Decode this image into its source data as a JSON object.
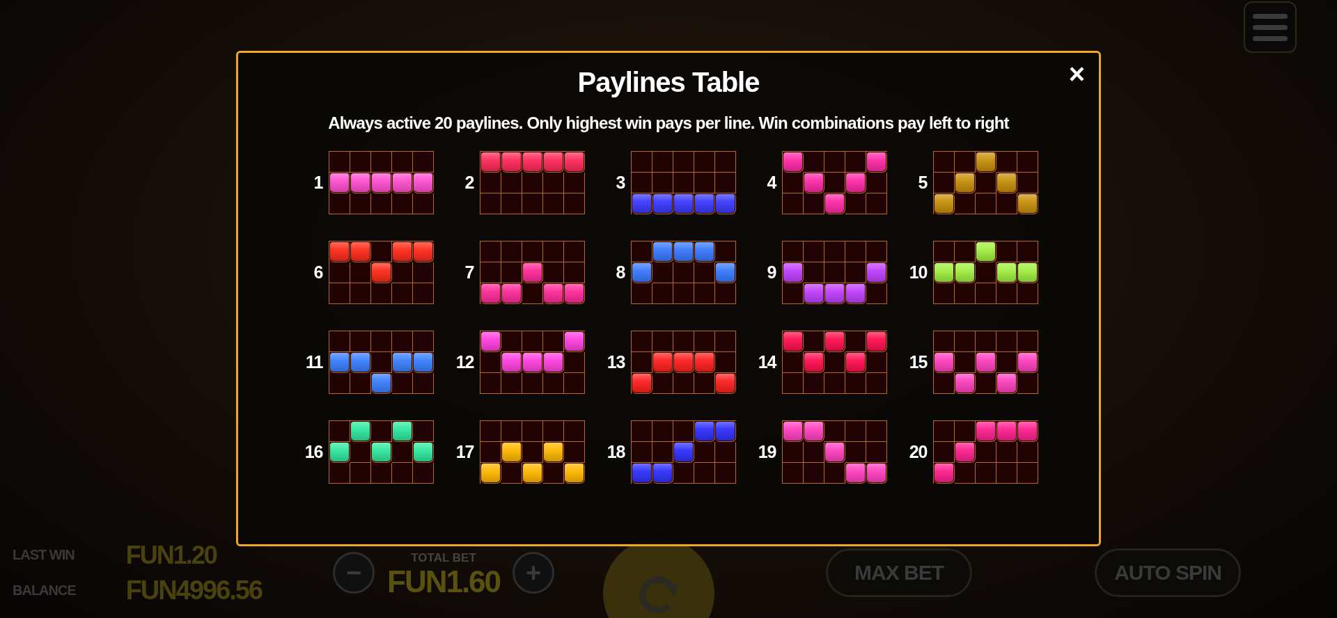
{
  "menu_button": {
    "kind": "menu"
  },
  "hud": {
    "last_win_label": "LAST WIN",
    "last_win": "FUN1.20",
    "balance_label": "BALANCE",
    "balance": "FUN4996.56",
    "total_bet_label": "TOTAL BET",
    "total_bet": "FUN1.60",
    "minus": "−",
    "plus": "+",
    "max_bet": "MAX BET",
    "auto_spin": "AUTO SPIN"
  },
  "modal": {
    "title": "Paylines Table",
    "close": "×",
    "subtitle": "Always active 20 paylines. Only highest win pays per line. Win combinations pay left to right"
  },
  "paylines": [
    {
      "number": "1",
      "color": "#ff4fd0",
      "grid": [
        [
          false,
          false,
          false,
          false,
          false
        ],
        [
          true,
          true,
          true,
          true,
          true
        ],
        [
          false,
          false,
          false,
          false,
          false
        ]
      ]
    },
    {
      "number": "2",
      "color": "#ff2a5a",
      "grid": [
        [
          true,
          true,
          true,
          true,
          true
        ],
        [
          false,
          false,
          false,
          false,
          false
        ],
        [
          false,
          false,
          false,
          false,
          false
        ]
      ]
    },
    {
      "number": "3",
      "color": "#3a3aff",
      "grid": [
        [
          false,
          false,
          false,
          false,
          false
        ],
        [
          false,
          false,
          false,
          false,
          false
        ],
        [
          true,
          true,
          true,
          true,
          true
        ]
      ]
    },
    {
      "number": "4",
      "color": "#ff2aa8",
      "grid": [
        [
          true,
          false,
          false,
          false,
          true
        ],
        [
          false,
          true,
          false,
          true,
          false
        ],
        [
          false,
          false,
          true,
          false,
          false
        ]
      ]
    },
    {
      "number": "5",
      "color": "#c8900a",
      "grid": [
        [
          false,
          false,
          true,
          false,
          false
        ],
        [
          false,
          true,
          false,
          true,
          false
        ],
        [
          true,
          false,
          false,
          false,
          true
        ]
      ]
    },
    {
      "number": "6",
      "color": "#ff2a1a",
      "grid": [
        [
          true,
          true,
          false,
          true,
          true
        ],
        [
          false,
          false,
          true,
          false,
          false
        ],
        [
          false,
          false,
          false,
          false,
          false
        ]
      ]
    },
    {
      "number": "7",
      "color": "#ff2a9a",
      "grid": [
        [
          false,
          false,
          false,
          false,
          false
        ],
        [
          false,
          false,
          true,
          false,
          false
        ],
        [
          true,
          true,
          false,
          true,
          true
        ]
      ]
    },
    {
      "number": "8",
      "color": "#3a7aff",
      "grid": [
        [
          false,
          true,
          true,
          true,
          false
        ],
        [
          true,
          false,
          false,
          false,
          true
        ],
        [
          false,
          false,
          false,
          false,
          false
        ]
      ]
    },
    {
      "number": "9",
      "color": "#c040ff",
      "grid": [
        [
          false,
          false,
          false,
          false,
          false
        ],
        [
          true,
          false,
          false,
          false,
          true
        ],
        [
          false,
          true,
          true,
          true,
          false
        ]
      ]
    },
    {
      "number": "10",
      "color": "#a0f040",
      "grid": [
        [
          false,
          false,
          true,
          false,
          false
        ],
        [
          true,
          true,
          false,
          true,
          true
        ],
        [
          false,
          false,
          false,
          false,
          false
        ]
      ]
    },
    {
      "number": "11",
      "color": "#3a80ff",
      "grid": [
        [
          false,
          false,
          false,
          false,
          false
        ],
        [
          true,
          true,
          false,
          true,
          true
        ],
        [
          false,
          false,
          true,
          false,
          false
        ]
      ]
    },
    {
      "number": "12",
      "color": "#ff40e0",
      "grid": [
        [
          true,
          false,
          false,
          false,
          true
        ],
        [
          false,
          true,
          true,
          true,
          false
        ],
        [
          false,
          false,
          false,
          false,
          false
        ]
      ]
    },
    {
      "number": "13",
      "color": "#ff2020",
      "grid": [
        [
          false,
          false,
          false,
          false,
          false
        ],
        [
          false,
          true,
          true,
          true,
          false
        ],
        [
          true,
          false,
          false,
          false,
          true
        ]
      ]
    },
    {
      "number": "14",
      "color": "#ff1050",
      "grid": [
        [
          true,
          false,
          true,
          false,
          true
        ],
        [
          false,
          true,
          false,
          true,
          false
        ],
        [
          false,
          false,
          false,
          false,
          false
        ]
      ]
    },
    {
      "number": "15",
      "color": "#ff40c0",
      "grid": [
        [
          false,
          false,
          false,
          false,
          false
        ],
        [
          true,
          false,
          true,
          false,
          true
        ],
        [
          false,
          true,
          false,
          true,
          false
        ]
      ]
    },
    {
      "number": "16",
      "color": "#30e8a0",
      "grid": [
        [
          false,
          true,
          false,
          true,
          false
        ],
        [
          true,
          false,
          true,
          false,
          true
        ],
        [
          false,
          false,
          false,
          false,
          false
        ]
      ]
    },
    {
      "number": "17",
      "color": "#ffb800",
      "grid": [
        [
          false,
          false,
          false,
          false,
          false
        ],
        [
          false,
          true,
          false,
          true,
          false
        ],
        [
          true,
          false,
          true,
          false,
          true
        ]
      ]
    },
    {
      "number": "18",
      "color": "#3030ff",
      "grid": [
        [
          false,
          false,
          false,
          true,
          true
        ],
        [
          false,
          false,
          true,
          false,
          false
        ],
        [
          true,
          true,
          false,
          false,
          false
        ]
      ]
    },
    {
      "number": "19",
      "color": "#ff40c0",
      "grid": [
        [
          true,
          true,
          false,
          false,
          false
        ],
        [
          false,
          false,
          true,
          false,
          false
        ],
        [
          false,
          false,
          false,
          true,
          true
        ]
      ]
    },
    {
      "number": "20",
      "color": "#ff2090",
      "grid": [
        [
          false,
          false,
          true,
          true,
          true
        ],
        [
          false,
          true,
          false,
          false,
          false
        ],
        [
          true,
          false,
          false,
          false,
          false
        ]
      ]
    }
  ]
}
